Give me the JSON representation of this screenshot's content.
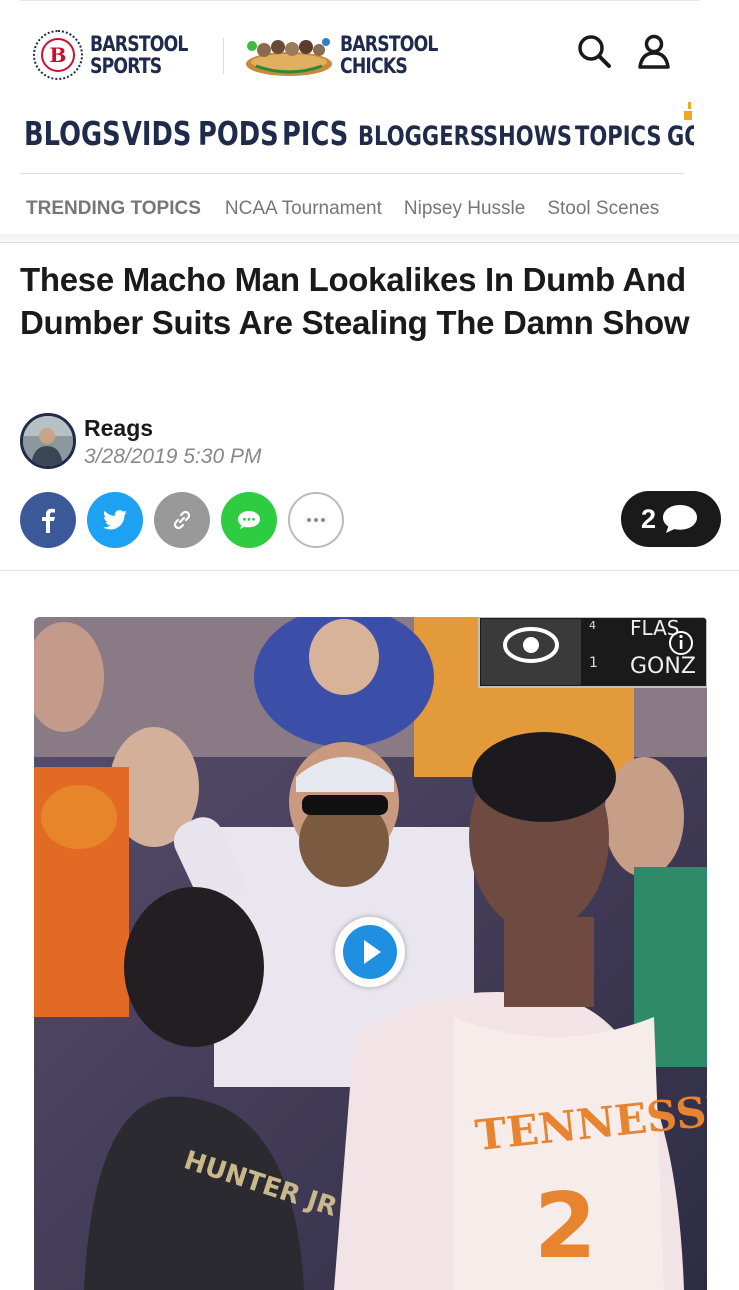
{
  "header": {
    "brand1_line1": "BARSTOOL",
    "brand1_line2": "SPORTS",
    "brand2_line1": "BARSTOOL",
    "brand2_line2": "CHICKS",
    "logo_glyph": "B"
  },
  "nav": {
    "items": [
      "BLOGS",
      "VIDS",
      "PODS",
      "PICS",
      "BLOGGERS",
      "SHOWS",
      "TOPICS",
      "GO"
    ]
  },
  "trending": {
    "label": "TRENDING TOPICS",
    "topics": [
      "NCAA Tournament",
      "Nipsey Hussle",
      "Stool Scenes"
    ]
  },
  "article": {
    "title": "These Macho Man Lookalikes In Dumb And Dumber Suits Are Stealing The Damn Show",
    "author": "Reags",
    "date": "3/28/2019 5:30 PM",
    "comment_count": "2"
  },
  "video": {
    "score_top": "FLAS",
    "score_bottom": "GONZ",
    "score_num1": "4",
    "score_num2": "1",
    "jersey_team": "TENNESSEE",
    "jersey_number": "2",
    "opponent_name": "HUNTER JR"
  },
  "colors": {
    "navy": "#1f2b4a",
    "facebook": "#3b5998",
    "twitter": "#1da1f2",
    "link": "#999999",
    "sms": "#2ecc40",
    "play": "#1e8fe1"
  }
}
